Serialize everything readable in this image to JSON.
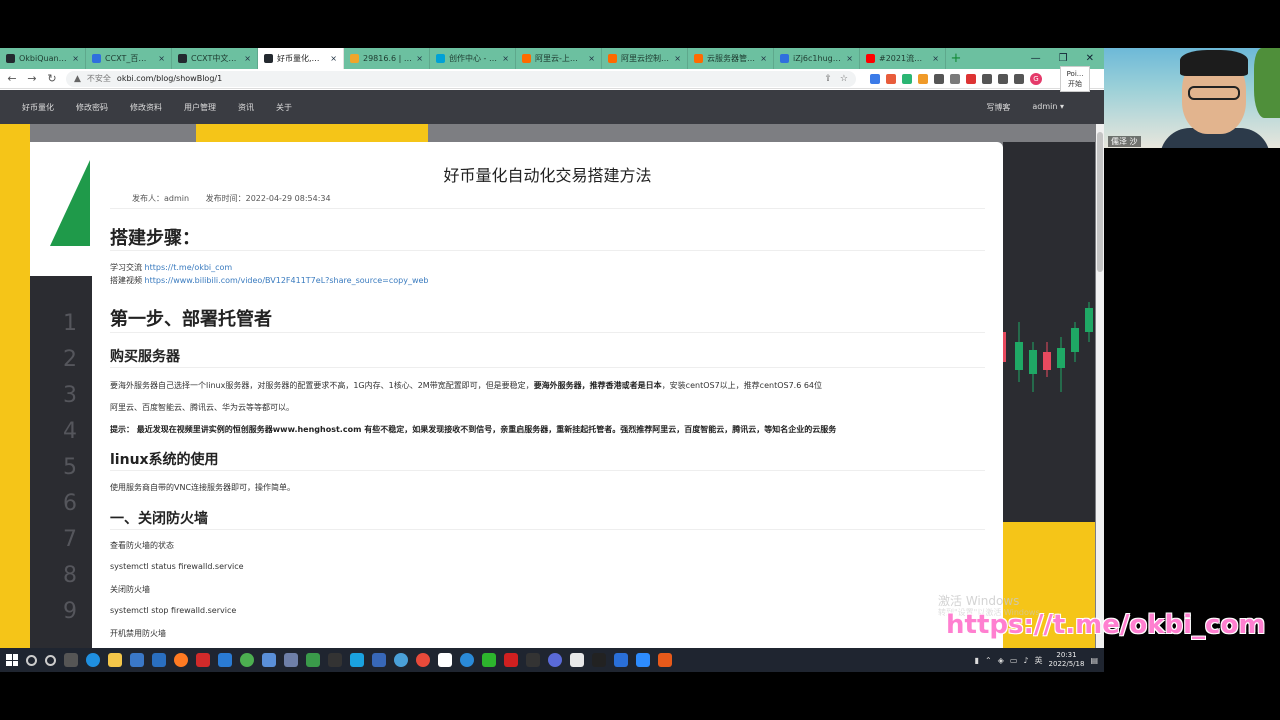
{
  "browser": {
    "tabs": [
      {
        "label": "OkbiQuant/c...",
        "color": "#24292f"
      },
      {
        "label": "CCXT_百度搜索",
        "color": "#2f6fde"
      },
      {
        "label": "CCXT中文开发...",
        "color": "#24292f"
      },
      {
        "label": "好币量化,博客",
        "color": "#24292f"
      },
      {
        "label": "29816.6 | BTC...",
        "color": "#f0a52a"
      },
      {
        "label": "创作中心 - 哔哩...",
        "color": "#00a1d6"
      },
      {
        "label": "阿里云-上云就...",
        "color": "#ff6a00"
      },
      {
        "label": "阿里云控制台首...",
        "color": "#ff6a00"
      },
      {
        "label": "云服务器管理控...",
        "color": "#ff6a00"
      },
      {
        "label": "iZj6c1hugdai...",
        "color": "#2f6fde"
      },
      {
        "label": "#2021流行歌曲...",
        "color": "#ff0000"
      }
    ],
    "address": {
      "insecure_label": "不安全",
      "url": "okbi.com/blog/showBlog/1"
    }
  },
  "sitenav": {
    "items": [
      "好币量化",
      "修改密码",
      "修改资料",
      "用户管理",
      "资讯",
      "关于"
    ],
    "write_blog": "写博客",
    "user": "admin ▾"
  },
  "article": {
    "title": "好币量化自动化交易搭建方法",
    "author_label": "发布人：admin",
    "time_label": "发布时间：2022-04-29 08:54:34",
    "h_steps": "搭建步骤：",
    "exchange_label": "学习交流",
    "exchange_link": "https://t.me/okbi_com",
    "video_label": "搭建视频",
    "video_link": "https://www.bilibili.com/video/BV12F411T7eL?share_source=copy_web",
    "h_step1": "第一步、部署托管者",
    "h_buy": "购买服务器",
    "buy_text_1": "要海外服务器自己选择一个linux服务器，对服务器的配置要求不高，1G内存、1核心、2M带宽配置即可，但是要稳定，",
    "buy_text_bold": "要海外服务器，推荐香港或者是日本",
    "buy_text_2": "，安装centOS7以上，推荐centOS7.6 64位",
    "providers": "阿里云、百度智能云、腾讯云、华为云等等都可以。",
    "tip_bold": "提示： 最近发现在视频里讲实例的恒创服务器www.henghost.com 有些不稳定，如果发现接收不到信号，亲重启服务器，重新挂起托管者。强烈推荐阿里云，百度智能云，腾讯云，等知名企业的云服务",
    "h_linux": "linux系统的使用",
    "linux_text": "使用服务商自带的VNC连接服务器即可，操作简单。",
    "h_firewall": "一、关闭防火墙",
    "fw_1": "查看防火墙的状态",
    "fw_2": "systemctl status firewalld.service",
    "fw_3": "关闭防火墙",
    "fw_4": "systemctl stop firewalld.service",
    "fw_5": "开机禁用防火墙"
  },
  "decor": {
    "line_numbers": [
      "1",
      "2",
      "3",
      "4",
      "5",
      "6",
      "7",
      "8",
      "9"
    ]
  },
  "watermark": {
    "activate": "激活 Windows",
    "activate_sub": "转到\"设置\"以激活 Windows。",
    "promo": "https://t.me/okbi_com"
  },
  "taskbar": {
    "time": "20:31",
    "date": "2022/5/18",
    "ime": "英"
  },
  "webcam": {
    "name": "儒泽 沙",
    "popup_top": "Poi...",
    "popup_btn": "开始"
  }
}
